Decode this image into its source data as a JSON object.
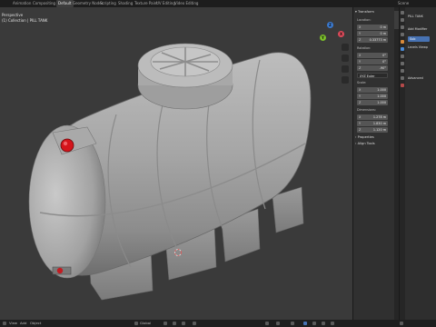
{
  "workspace_tabs": [
    "Animation",
    "Compositing",
    "Default",
    "Geometry Nodes",
    "Scripting",
    "Shading",
    "Texture Paint",
    "UV Editing",
    "Video Editing"
  ],
  "active_tab": "Default",
  "scene_label": "Scene",
  "viewport": {
    "mode_label": "Perspective",
    "collection_label": "(1) Collection | PILL TANK"
  },
  "gizmo": {
    "x": "X",
    "y": "Y",
    "z": "Z"
  },
  "npanel": {
    "header": "Transform",
    "location_label": "Location:",
    "location": [
      {
        "axis": "X",
        "value": "0 m"
      },
      {
        "axis": "Y",
        "value": "0 m"
      },
      {
        "axis": "Z",
        "value": "0.33773 m"
      }
    ],
    "rotation_label": "Rotation:",
    "rotation": [
      {
        "axis": "X",
        "value": "0°"
      },
      {
        "axis": "Y",
        "value": "0°"
      },
      {
        "axis": "Z",
        "value": "-90°"
      }
    ],
    "rotation_mode": "XYZ Euler",
    "scale_label": "Scale:",
    "scale": [
      {
        "axis": "X",
        "value": "1.000"
      },
      {
        "axis": "Y",
        "value": "1.000"
      },
      {
        "axis": "Z",
        "value": "1.000"
      }
    ],
    "dimensions_label": "Dimensions:",
    "dimensions": [
      {
        "axis": "X",
        "value": "1.278 m"
      },
      {
        "axis": "Y",
        "value": "1.830 m"
      },
      {
        "axis": "Z",
        "value": "1.120 m"
      }
    ],
    "properties_label": "Properties",
    "align_tools_label": "Align Tools"
  },
  "props_panel": {
    "object_name": "PILL TANK",
    "add_modifier": "Add Modifier",
    "row3": "Sub",
    "row4": "Levels Viewp",
    "advanced": "Advanced"
  },
  "bottom_bar": {
    "object_menu": "Object",
    "view_menu": "View",
    "add_menu": "Add",
    "orientation": "Global"
  },
  "colors": {
    "viewport_bg": "#3a3a3a",
    "tank_body": "#a3a3a3",
    "cap_red": "#d4141b",
    "accent_blue": "#4772b3"
  }
}
